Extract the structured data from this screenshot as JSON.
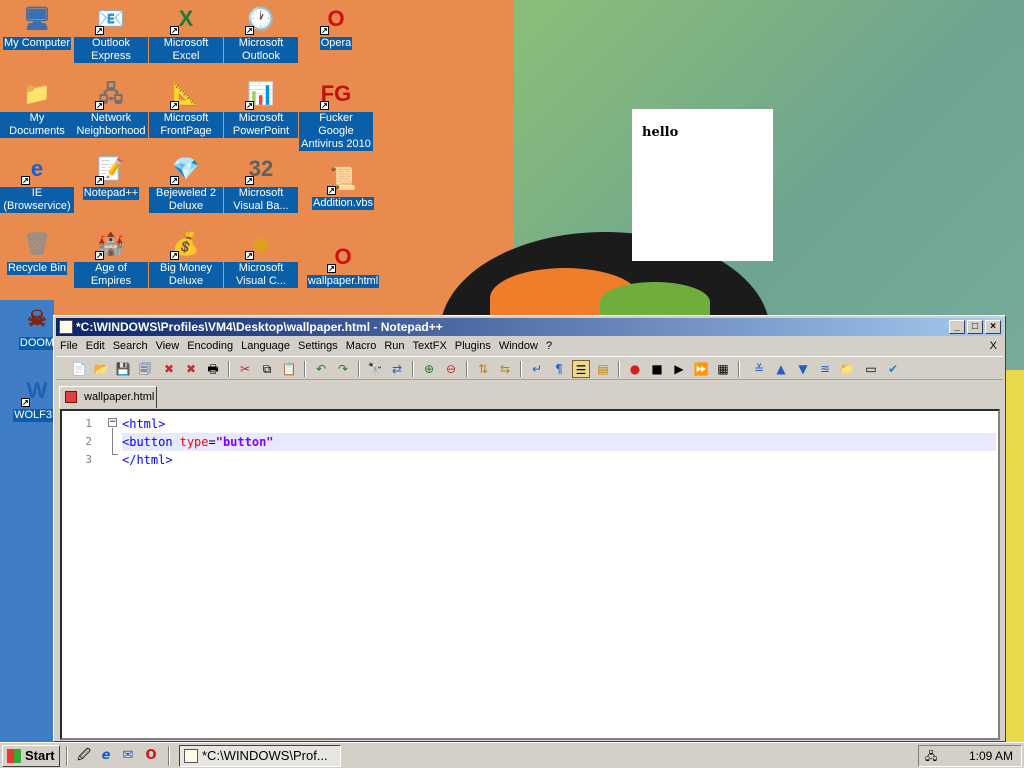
{
  "desktop_icons": [
    {
      "name": "My Computer",
      "glyph": "🖥"
    },
    {
      "name": "Outlook Express",
      "glyph": "📧"
    },
    {
      "name": "Microsoft Excel",
      "glyph": "X"
    },
    {
      "name": "Microsoft Outlook",
      "glyph": "🕐"
    },
    {
      "name": "Opera",
      "glyph": "O"
    },
    {
      "name": "My Documents",
      "glyph": "📁"
    },
    {
      "name": "Network Neighborhood",
      "glyph": "🖧"
    },
    {
      "name": "Microsoft FrontPage",
      "glyph": "📐"
    },
    {
      "name": "Microsoft PowerPoint",
      "glyph": "📊"
    },
    {
      "name": "Fucker Google Antivirus 2010",
      "glyph": "FG"
    },
    {
      "name": "IE (Browservice)",
      "glyph": "e"
    },
    {
      "name": "Notepad++",
      "glyph": "📝"
    },
    {
      "name": "Bejeweled 2 Deluxe",
      "glyph": "💎"
    },
    {
      "name": "Microsoft Visual Ba...",
      "glyph": "32"
    },
    {
      "name": "Addition.vbs",
      "glyph": "📜"
    },
    {
      "name": "Recycle Bin",
      "glyph": "🗑"
    },
    {
      "name": "Age of Empires",
      "glyph": "🏰"
    },
    {
      "name": "Big Money Deluxe",
      "glyph": "💰"
    },
    {
      "name": "Microsoft Visual C...",
      "glyph": "◆"
    },
    {
      "name": "wallpaper.html",
      "glyph": "O"
    },
    {
      "name": "DOOM",
      "glyph": "☠"
    },
    {
      "name": "WOLF3D",
      "glyph": "W"
    }
  ],
  "wallpaper_box": {
    "text": "hello"
  },
  "window": {
    "title": "*C:\\WINDOWS\\Profiles\\VM4\\Desktop\\wallpaper.html - Notepad++",
    "menu": [
      "File",
      "Edit",
      "Search",
      "View",
      "Encoding",
      "Language",
      "Settings",
      "Macro",
      "Run",
      "TextFX",
      "Plugins",
      "Window",
      "?"
    ],
    "menu_close": "X",
    "tab_label": "wallpaper.html",
    "lines": [
      {
        "num": "1",
        "open": "<",
        "tag": "html",
        "close": ">"
      },
      {
        "num": "2",
        "open": "<",
        "tag": "button",
        "attr": "type",
        "eq": "=",
        "value": "\"button\""
      },
      {
        "num": "3",
        "open": "</",
        "tag": "html",
        "close": ">"
      }
    ]
  },
  "taskbar": {
    "start_label": "Start",
    "task_label": "*C:\\WINDOWS\\Prof...",
    "clock": "1:09 AM"
  }
}
